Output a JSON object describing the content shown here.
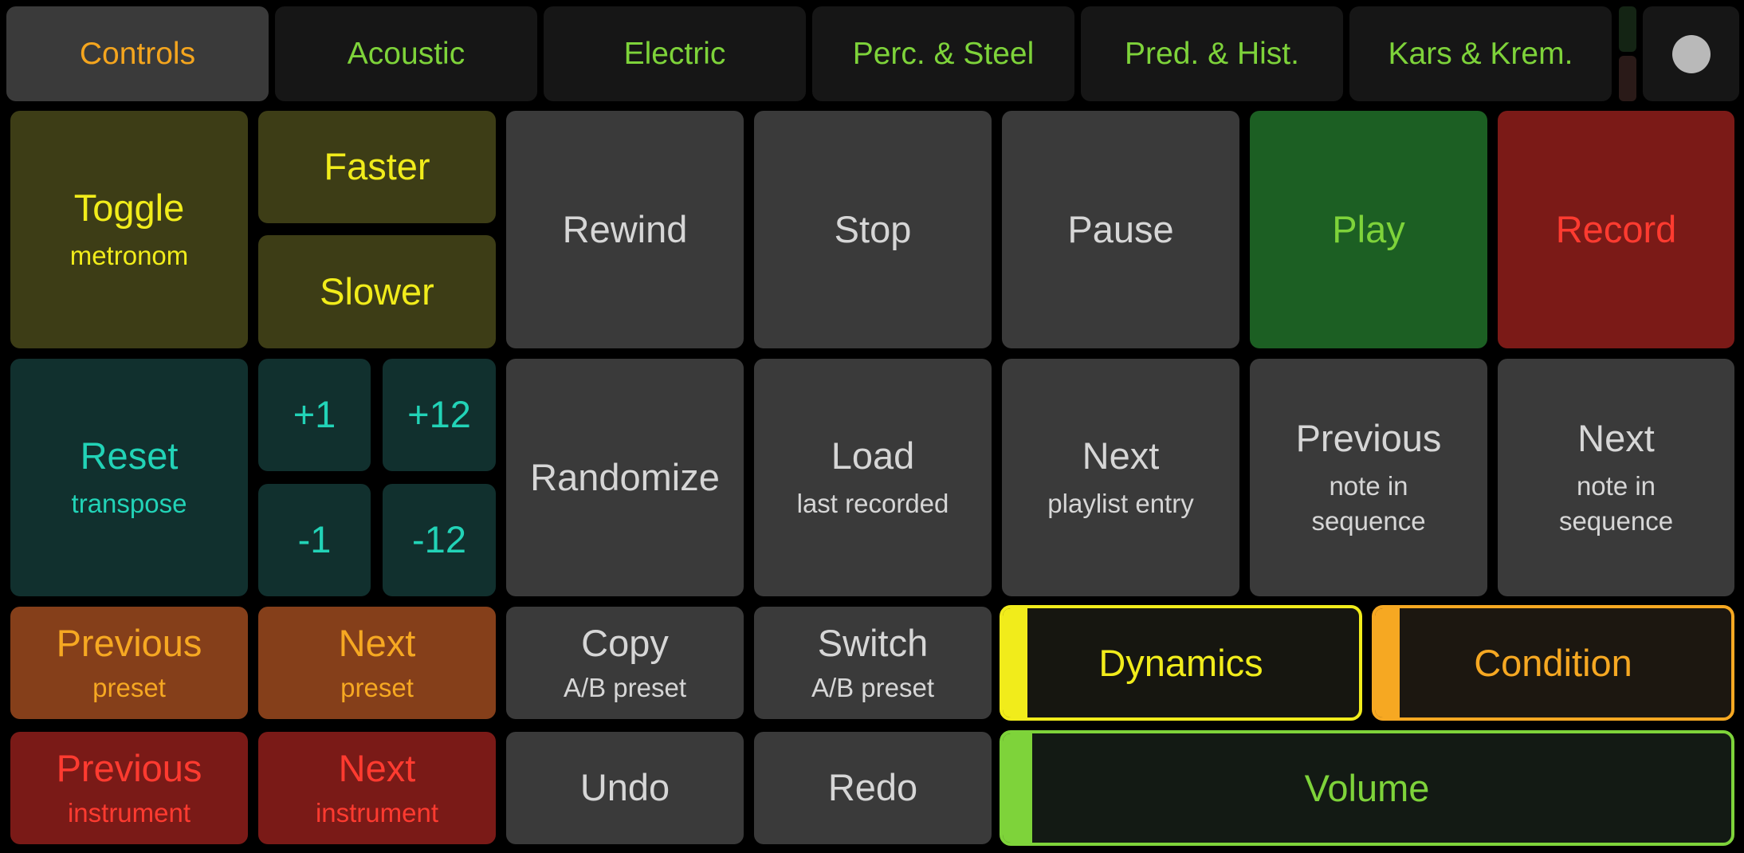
{
  "tabs": [
    {
      "label": "Controls",
      "active": true
    },
    {
      "label": "Acoustic",
      "active": false
    },
    {
      "label": "Electric",
      "active": false
    },
    {
      "label": "Perc. & Steel",
      "active": false
    },
    {
      "label": "Pred. & Hist.",
      "active": false
    },
    {
      "label": "Kars & Krem.",
      "active": false
    }
  ],
  "metronome": {
    "toggle": {
      "main": "Toggle",
      "sub": "metronom"
    },
    "faster": "Faster",
    "slower": "Slower"
  },
  "transport": {
    "rewind": "Rewind",
    "stop": "Stop",
    "pause": "Pause",
    "play": "Play",
    "record": "Record"
  },
  "transpose": {
    "reset": {
      "main": "Reset",
      "sub": "transpose"
    },
    "plus1": "+1",
    "plus12": "+12",
    "minus1": "-1",
    "minus12": "-12"
  },
  "sequence": {
    "randomize": "Randomize",
    "load": {
      "main": "Load",
      "sub": "last recorded"
    },
    "next_playlist": {
      "main": "Next",
      "sub": "playlist entry"
    },
    "prev_note": {
      "main": "Previous",
      "sub1": "note in",
      "sub2": "sequence"
    },
    "next_note": {
      "main": "Next",
      "sub1": "note in",
      "sub2": "sequence"
    }
  },
  "presets": {
    "previous": {
      "main": "Previous",
      "sub": "preset"
    },
    "next": {
      "main": "Next",
      "sub": "preset"
    },
    "copy": {
      "main": "Copy",
      "sub": "A/B preset"
    },
    "switch": {
      "main": "Switch",
      "sub": "A/B preset"
    }
  },
  "instruments": {
    "previous": {
      "main": "Previous",
      "sub": "instrument"
    },
    "next": {
      "main": "Next",
      "sub": "instrument"
    }
  },
  "history": {
    "undo": "Undo",
    "redo": "Redo"
  },
  "sliders": {
    "dynamics": {
      "label": "Dynamics",
      "level": 0.07
    },
    "condition": {
      "label": "Condition",
      "level": 0.07
    },
    "volume": {
      "label": "Volume",
      "level": 0.04
    }
  },
  "colors": {
    "olive": "#3d3d16",
    "teal": "#11302e",
    "grey": "#3a3a3a",
    "play_green": "#1c5f23",
    "record_red": "#7b1a17",
    "preset_orange": "#853f1a",
    "accent_yellow": "#f1ec1b",
    "accent_orange": "#f6a822",
    "accent_green": "#7ed33a"
  }
}
